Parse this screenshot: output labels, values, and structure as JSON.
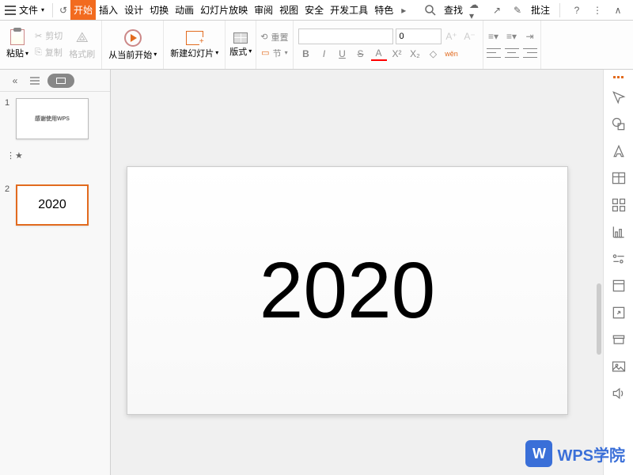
{
  "menu": {
    "file": "文件",
    "tabs": [
      "开始",
      "插入",
      "设计",
      "切换",
      "动画",
      "幻灯片放映",
      "审阅",
      "视图",
      "安全",
      "开发工具",
      "特色"
    ],
    "active_index": 0,
    "search": "查找",
    "annotate": "批注"
  },
  "ribbon": {
    "paste": "粘贴",
    "cut": "剪切",
    "copy": "复制",
    "format_painter": "格式刷",
    "play_from": "从当前开始",
    "new_slide": "新建幻灯片",
    "layout": "版式",
    "reset": "重置",
    "section": "节",
    "font_name": "",
    "font_size": "0",
    "bold": "B",
    "italic": "I",
    "underline": "U",
    "strike": "S",
    "text_effect": "A",
    "super": "X²",
    "sub": "X₂",
    "clear": "◇",
    "pinyin": "wěn"
  },
  "thumbs": {
    "slide1_num": "1",
    "slide1_title": "感谢使用WPS",
    "slide1_sub": "",
    "star": "⋮★",
    "slide2_num": "2",
    "slide2_text": "2020"
  },
  "canvas": {
    "text": "2020"
  },
  "watermark": {
    "logo": "W",
    "text": "WPS学院"
  }
}
